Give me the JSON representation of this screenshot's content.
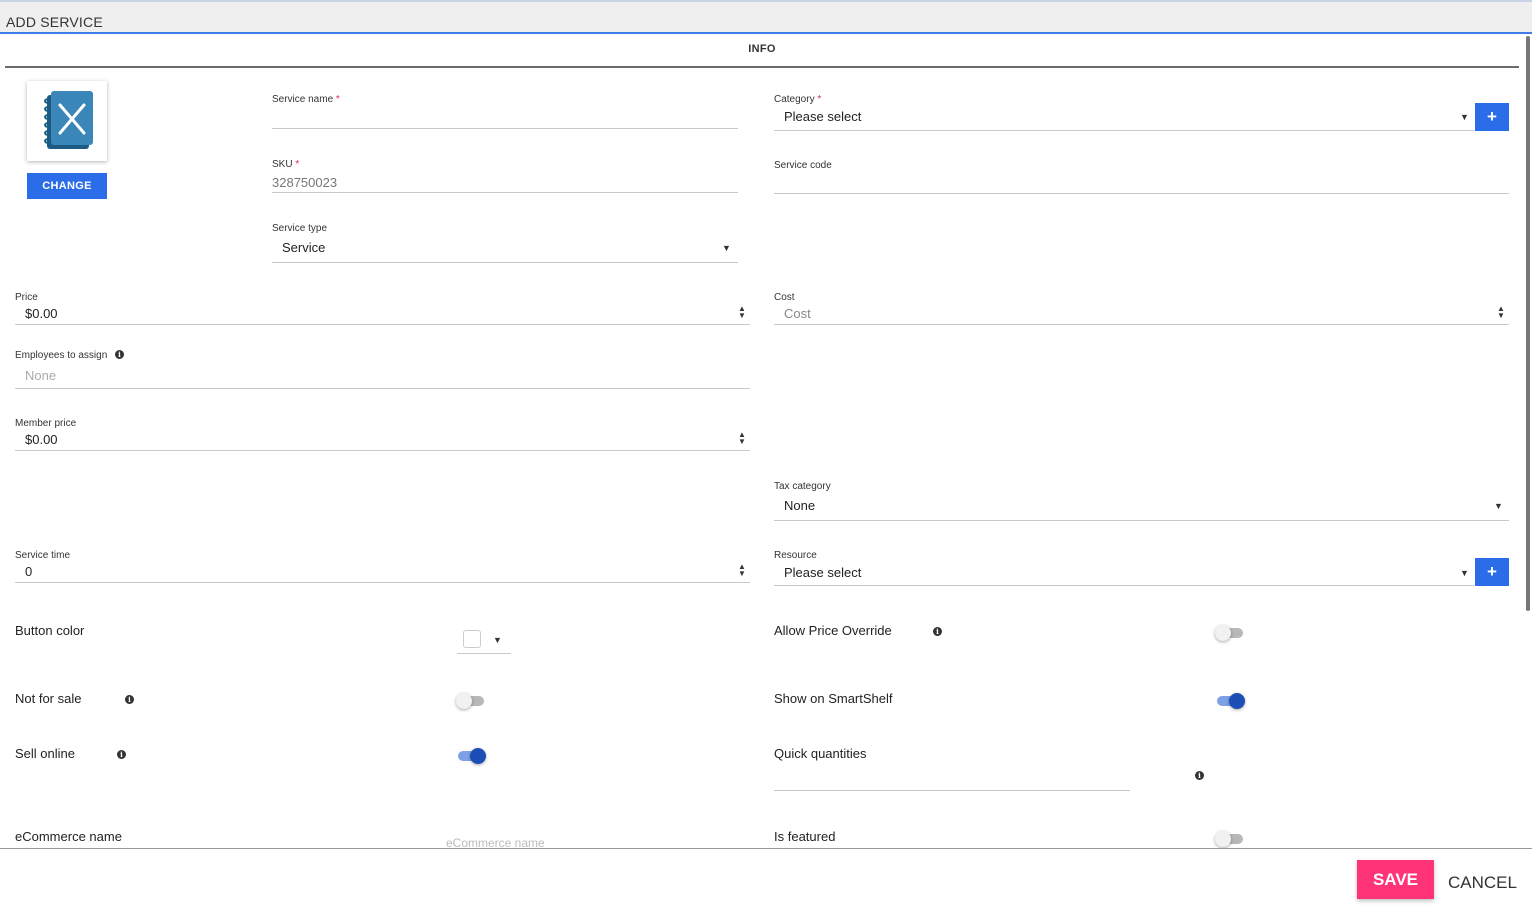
{
  "window": {
    "title": "ADD SERVICE"
  },
  "tabs": [
    {
      "label": "INFO"
    }
  ],
  "image": {
    "change_label": "CHANGE",
    "icon": "menu-book-icon"
  },
  "fields": {
    "service_name": {
      "label": "Service name",
      "required_mark": "*",
      "value": ""
    },
    "category": {
      "label": "Category",
      "required_mark": "*",
      "value": "Please select"
    },
    "sku": {
      "label": "SKU",
      "required_mark": "*",
      "value": "328750023"
    },
    "service_code": {
      "label": "Service code",
      "value": ""
    },
    "service_type": {
      "label": "Service type",
      "value": "Service"
    },
    "price": {
      "label": "Price",
      "value": "$0.00"
    },
    "cost": {
      "label": "Cost",
      "placeholder": "Cost"
    },
    "employees": {
      "label": "Employees to assign",
      "placeholder": "None"
    },
    "member_price": {
      "label": "Member price",
      "value": "$0.00"
    },
    "tax_category": {
      "label": "Tax category",
      "value": "None"
    },
    "service_time": {
      "label": "Service time",
      "value": "0"
    },
    "resource": {
      "label": "Resource",
      "value": "Please select"
    }
  },
  "settings": {
    "button_color": {
      "label": "Button color",
      "value": "#ffffff"
    },
    "allow_price_override": {
      "label": "Allow Price Override",
      "on": false
    },
    "not_for_sale": {
      "label": "Not for sale",
      "on": false
    },
    "show_on_smartshelf": {
      "label": "Show on SmartShelf",
      "on": true
    },
    "sell_online": {
      "label": "Sell online",
      "on": true
    },
    "quick_quantities": {
      "label": "Quick quantities",
      "value": ""
    },
    "ecommerce_name": {
      "label": "eCommerce name",
      "placeholder": "eCommerce name"
    },
    "is_featured": {
      "label": "Is featured",
      "on": false
    }
  },
  "footer": {
    "save_label": "SAVE",
    "cancel_label": "CANCEL"
  },
  "colors": {
    "accent": "#2b6de8",
    "save": "#ff3377",
    "toggle_on": "#1b4fb5"
  }
}
